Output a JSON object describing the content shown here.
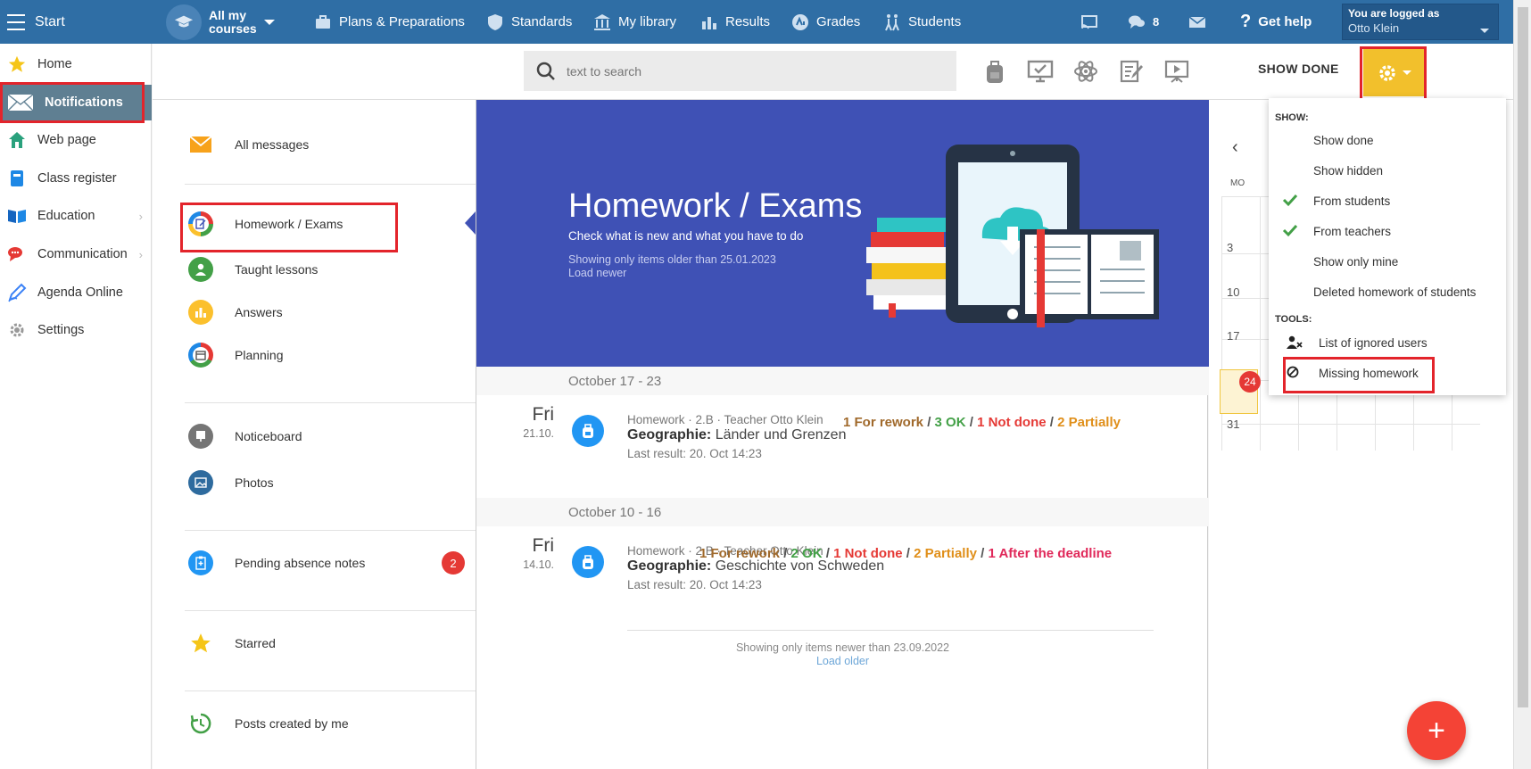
{
  "topbar": {
    "start": "Start",
    "courses_line1": "All my",
    "courses_line2": "courses",
    "plans": "Plans & Preparations",
    "standards": "Standards",
    "library": "My library",
    "results": "Results",
    "grades": "Grades",
    "students": "Students",
    "chat_count": "8",
    "help": "Get help",
    "logged_as": "You are logged as",
    "user": "Otto Klein"
  },
  "leftnav": {
    "items": [
      {
        "label": "Home",
        "icon": "star-icon"
      },
      {
        "label": "Notifications",
        "icon": "envelope-icon"
      },
      {
        "label": "Web page",
        "icon": "house-icon"
      },
      {
        "label": "Class register",
        "icon": "book-icon"
      },
      {
        "label": "Education",
        "icon": "open-book-icon"
      },
      {
        "label": "Communication",
        "icon": "chat-icon"
      },
      {
        "label": "Agenda Online",
        "icon": "pen-icon"
      },
      {
        "label": "Settings",
        "icon": "gear-icon"
      }
    ],
    "chevron": "›"
  },
  "toolbar": {
    "search_placeholder": "text to search",
    "show_done": "SHOW DONE"
  },
  "folders": {
    "all_messages": "All messages",
    "homework_exams": "Homework / Exams",
    "taught_lessons": "Taught lessons",
    "answers": "Answers",
    "planning": "Planning",
    "noticeboard": "Noticeboard",
    "photos": "Photos",
    "pending_absence": "Pending absence notes",
    "pending_count": "2",
    "starred": "Starred",
    "posts_by_me": "Posts created by me"
  },
  "hero": {
    "title": "Homework / Exams",
    "subtitle": "Check what is new and what you have to do",
    "note": "Showing only items older than 25.01.2023",
    "load_newer": "Load newer"
  },
  "weeks": [
    {
      "label": "October 17 - 23",
      "entry": {
        "day": "Fri",
        "date": "21.10.",
        "meta": "Homework · 2.B · Teacher Otto Klein",
        "subject": "Geographie:",
        "topic": "Länder und Grenzen",
        "last": "Last result: 20. Oct 14:23",
        "stats": [
          {
            "text": "1 For rework",
            "cls": "c-rework"
          },
          {
            "text": "3 OK",
            "cls": "c-ok"
          },
          {
            "text": "1 Not done",
            "cls": "c-notdone"
          },
          {
            "text": "2 Partially",
            "cls": "c-partial"
          }
        ]
      }
    },
    {
      "label": "October 10 - 16",
      "entry": {
        "day": "Fri",
        "date": "14.10.",
        "meta": "Homework · 2.B · Teacher Otto Klein",
        "subject": "Geographie:",
        "topic": "Geschichte von Schweden",
        "last": "Last result: 20. Oct 14:23",
        "stats": [
          {
            "text": "1 For rework",
            "cls": "c-rework"
          },
          {
            "text": "2 OK",
            "cls": "c-ok"
          },
          {
            "text": "1 Not done",
            "cls": "c-notdone"
          },
          {
            "text": "2 Partially",
            "cls": "c-partial"
          },
          {
            "text": "1 After the deadline",
            "cls": "c-late"
          }
        ]
      }
    }
  ],
  "footer": {
    "note": "Showing only items newer than 23.09.2022",
    "load_older": "Load older"
  },
  "calendar": {
    "dow": "MO",
    "days": [
      "3",
      "10",
      "17",
      "24",
      "31"
    ],
    "today_badge": "24",
    "nav_prev": "‹"
  },
  "dropdown": {
    "show_label": "SHOW:",
    "show_items": [
      {
        "label": "Show done",
        "checked": false
      },
      {
        "label": "Show hidden",
        "checked": false
      },
      {
        "label": "From students",
        "checked": true
      },
      {
        "label": "From teachers",
        "checked": true
      },
      {
        "label": "Show only mine",
        "checked": false
      },
      {
        "label": "Deleted homework of students",
        "checked": false
      }
    ],
    "tools_label": "TOOLS:",
    "tools": [
      {
        "label": "List of ignored users",
        "icon": "user-x-icon"
      },
      {
        "label": "Missing homework",
        "icon": "ban-icon"
      }
    ]
  },
  "fab": "+",
  "colors": {
    "topbar": "#2f6ea5",
    "hero": "#3f51b5",
    "gear_button": "#f2c02c",
    "highlight": "#e3242b",
    "fab": "#f44336"
  }
}
